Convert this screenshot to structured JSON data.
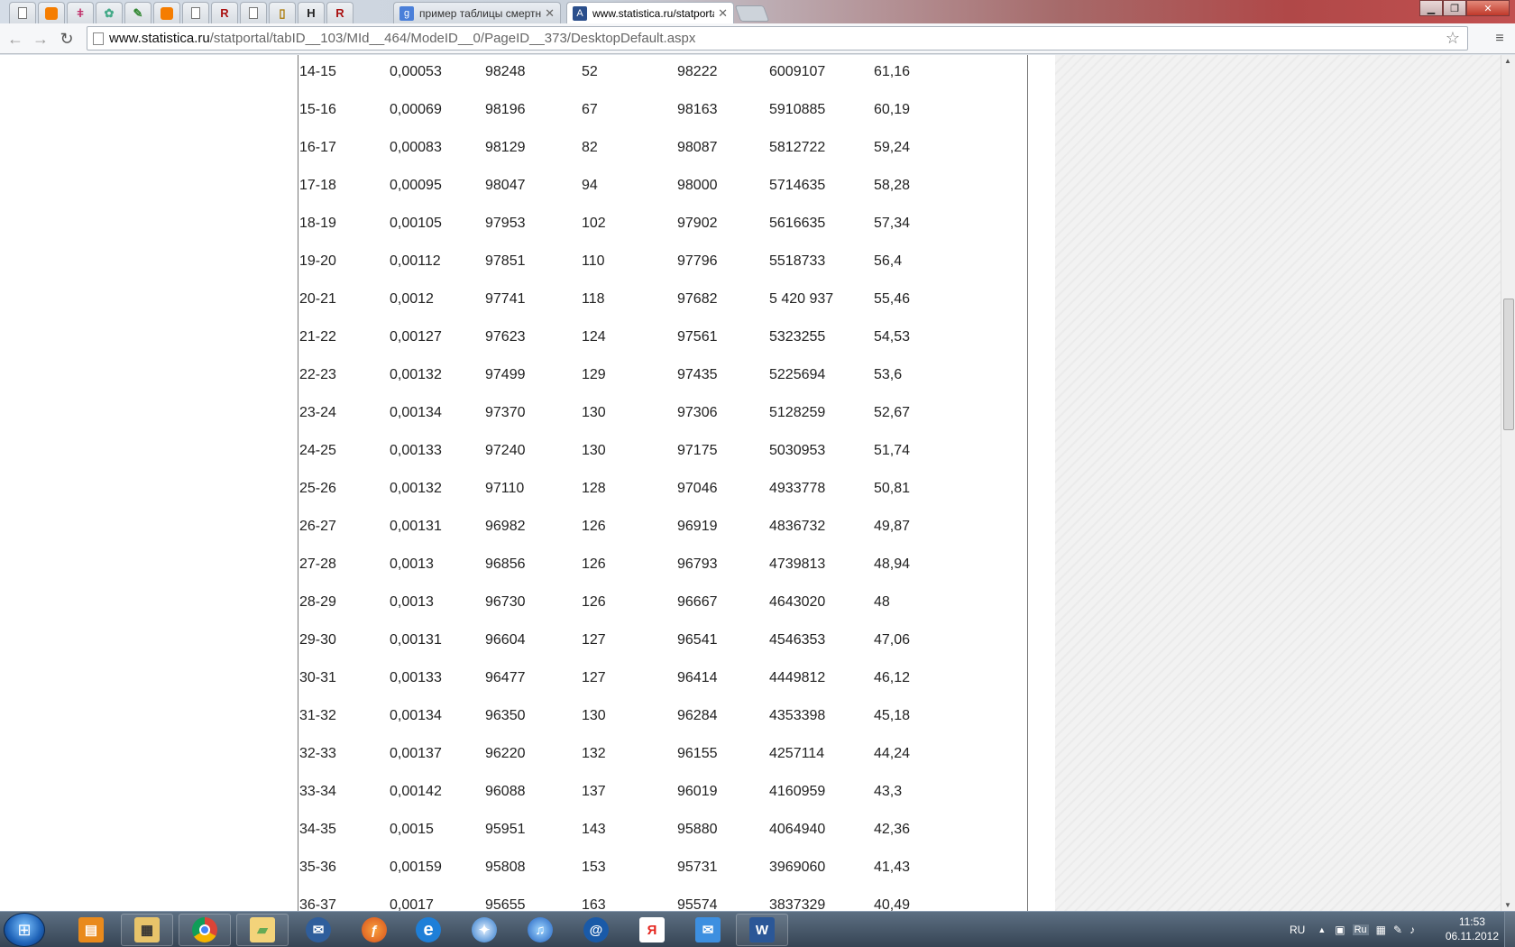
{
  "browser": {
    "tabs": [
      {
        "title": "пример таблицы смертно",
        "icon": "google-icon"
      },
      {
        "title": "www.statistica.ru/statporta",
        "icon": "statistica-icon",
        "active": true
      }
    ],
    "url_host": "www.statistica.ru",
    "url_path": "/statportal/tabID__103/MId__464/ModeID__0/PageID__373/DesktopDefault.aspx"
  },
  "table": {
    "rows": [
      [
        "14-15",
        "0,00053",
        "98248",
        "52",
        "98222",
        "6009107",
        "61,16"
      ],
      [
        "15-16",
        "0,00069",
        "98196",
        "67",
        "98163",
        "5910885",
        "60,19"
      ],
      [
        "16-17",
        "0,00083",
        "98129",
        "82",
        "98087",
        "5812722",
        "59,24"
      ],
      [
        "17-18",
        "0,00095",
        "98047",
        "94",
        "98000",
        "5714635",
        "58,28"
      ],
      [
        "18-19",
        "0,00105",
        "97953",
        "102",
        "97902",
        "5616635",
        "57,34"
      ],
      [
        "19-20",
        "0,00112",
        "97851",
        "110",
        "97796",
        "5518733",
        "56,4"
      ],
      [
        "20-21",
        "0,0012",
        "97741",
        "118",
        "97682",
        "5 420 937",
        "55,46"
      ],
      [
        "21-22",
        "0,00127",
        "97623",
        "124",
        "97561",
        "5323255",
        "54,53"
      ],
      [
        "22-23",
        "0,00132",
        "97499",
        "129",
        "97435",
        "5225694",
        "53,6"
      ],
      [
        "23-24",
        "0,00134",
        "97370",
        "130",
        "97306",
        "5128259",
        "52,67"
      ],
      [
        "24-25",
        "0,00133",
        "97240",
        "130",
        "97175",
        "5030953",
        "51,74"
      ],
      [
        "25-26",
        "0,00132",
        "97110",
        "128",
        "97046",
        "4933778",
        "50,81"
      ],
      [
        "26-27",
        "0,00131",
        "96982",
        "126",
        "96919",
        "4836732",
        "49,87"
      ],
      [
        "27-28",
        "0,0013",
        "96856",
        "126",
        "96793",
        "4739813",
        "48,94"
      ],
      [
        "28-29",
        "0,0013",
        "96730",
        "126",
        "96667",
        "4643020",
        "48"
      ],
      [
        "29-30",
        "0,00131",
        "96604",
        "127",
        "96541",
        "4546353",
        "47,06"
      ],
      [
        "30-31",
        "0,00133",
        "96477",
        "127",
        "96414",
        "4449812",
        "46,12"
      ],
      [
        "31-32",
        "0,00134",
        "96350",
        "130",
        "96284",
        "4353398",
        "45,18"
      ],
      [
        "32-33",
        "0,00137",
        "96220",
        "132",
        "96155",
        "4257114",
        "44,24"
      ],
      [
        "33-34",
        "0,00142",
        "96088",
        "137",
        "96019",
        "4160959",
        "43,3"
      ],
      [
        "34-35",
        "0,0015",
        "95951",
        "143",
        "95880",
        "4064940",
        "42,36"
      ],
      [
        "35-36",
        "0,00159",
        "95808",
        "153",
        "95731",
        "3969060",
        "41,43"
      ],
      [
        "36-37",
        "0,0017",
        "95655",
        "163",
        "95574",
        "3837329",
        "40,49"
      ]
    ]
  },
  "taskbar": {
    "language": "RU",
    "tray_lang": "Ru",
    "time": "11:53",
    "date": "06.11.2012",
    "apps": [
      "explorer-app",
      "file-manager-app",
      "chrome-app",
      "folder-app",
      "mail-app",
      "firefox-app",
      "ie-app",
      "safari-app",
      "itunes-app",
      "qip-app",
      "yandex-app",
      "email-app",
      "word-app"
    ]
  }
}
